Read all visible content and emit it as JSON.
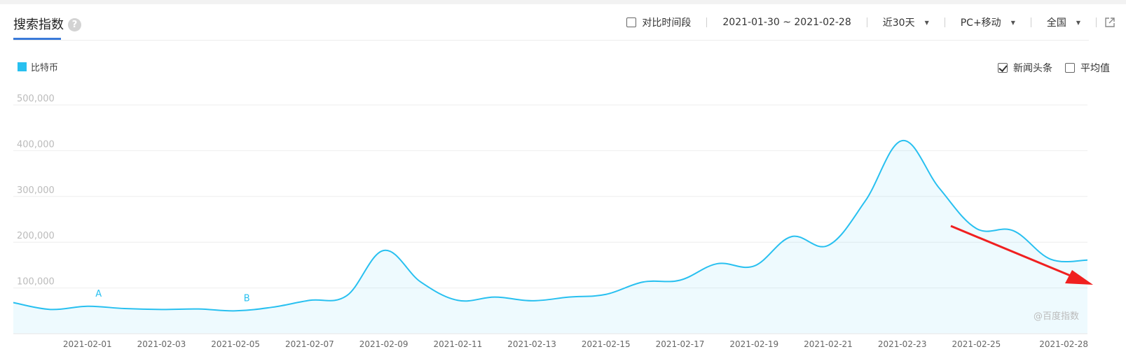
{
  "header": {
    "title": "搜索指数",
    "help_icon": "question-circle-icon",
    "compare_label": "对比时间段",
    "date_range": "2021-01-30 ~ 2021-02-28",
    "period": "近30天",
    "device": "PC+移动",
    "region": "全国",
    "share_icon": "external-link-icon"
  },
  "legend": {
    "label": "比特币",
    "color": "#28c0f0"
  },
  "options": {
    "news": {
      "label": "新闻头条",
      "checked": true
    },
    "average": {
      "label": "平均值",
      "checked": false
    }
  },
  "watermark": "@百度指数",
  "chart_data": {
    "type": "area",
    "x": [
      "2021-01-30",
      "2021-01-31",
      "2021-02-01",
      "2021-02-02",
      "2021-02-03",
      "2021-02-04",
      "2021-02-05",
      "2021-02-06",
      "2021-02-07",
      "2021-02-08",
      "2021-02-09",
      "2021-02-10",
      "2021-02-11",
      "2021-02-12",
      "2021-02-13",
      "2021-02-14",
      "2021-02-15",
      "2021-02-16",
      "2021-02-17",
      "2021-02-18",
      "2021-02-19",
      "2021-02-20",
      "2021-02-21",
      "2021-02-22",
      "2021-02-23",
      "2021-02-24",
      "2021-02-25",
      "2021-02-26",
      "2021-02-27",
      "2021-02-28"
    ],
    "x_tick_labels": [
      "2021-02-01",
      "2021-02-03",
      "2021-02-05",
      "2021-02-07",
      "2021-02-09",
      "2021-02-11",
      "2021-02-13",
      "2021-02-15",
      "2021-02-17",
      "2021-02-19",
      "2021-02-21",
      "2021-02-23",
      "2021-02-25",
      "2021-02-28"
    ],
    "series": [
      {
        "name": "比特币",
        "values": [
          68000,
          53000,
          60000,
          55000,
          53000,
          54000,
          50000,
          58000,
          73000,
          83000,
          182000,
          113000,
          73000,
          80000,
          72000,
          80000,
          86000,
          113000,
          117000,
          153000,
          148000,
          212000,
          193000,
          290000,
          422000,
          318000,
          230000,
          225000,
          163000,
          161000
        ]
      }
    ],
    "y_tick_labels": [
      "100,000",
      "200,000",
      "300,000",
      "400,000",
      "500,000"
    ],
    "ylim": [
      0,
      500000
    ],
    "grid": true,
    "annotations": [
      {
        "label": "A",
        "date": "2021-02-01"
      },
      {
        "label": "B",
        "date": "2021-02-05"
      }
    ]
  }
}
